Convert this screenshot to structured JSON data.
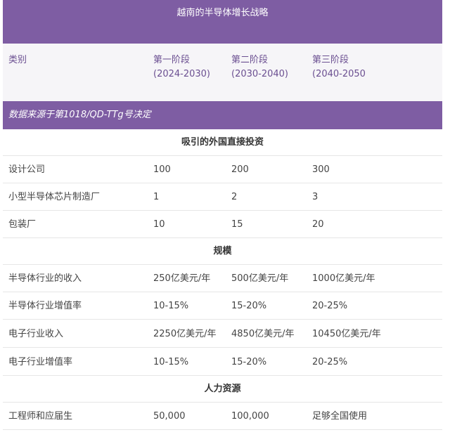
{
  "title": "越南的半导体增长战略",
  "header": {
    "category": "类别",
    "phase1": {
      "name": "第一阶段",
      "years": "(2024-2030)"
    },
    "phase2": {
      "name": "第二阶段",
      "years": "(2030-2040)"
    },
    "phase3": {
      "name": "第三阶段",
      "years": "(2040-2050"
    }
  },
  "source": "数据来源于第1018/QD-TTg号决定",
  "sections": [
    {
      "title": "吸引的外国直接投资",
      "rows": [
        [
          "设计公司",
          "100",
          "200",
          "300"
        ],
        [
          "小型半导体芯片制造厂",
          "1",
          "2",
          "3"
        ],
        [
          "包装厂",
          "10",
          "15",
          "20"
        ]
      ]
    },
    {
      "title": "规模",
      "rows": [
        [
          "半导体行业的收入",
          "250亿美元/年",
          "500亿美元/年",
          "1000亿美元/年"
        ],
        [
          "半导体行业增值率",
          "10-15%",
          "15-20%",
          "20-25%"
        ],
        [
          "电子行业收入",
          "2250亿美元/年",
          "4850亿美元/年",
          "10450亿美元/年"
        ],
        [
          "电子行业增值率",
          "10-15%",
          "15-20%",
          "20-25%"
        ]
      ]
    },
    {
      "title": "人力资源",
      "rows": [
        [
          "工程师和应届生",
          "50,000",
          "100,000",
          "足够全国使用"
        ]
      ]
    }
  ]
}
